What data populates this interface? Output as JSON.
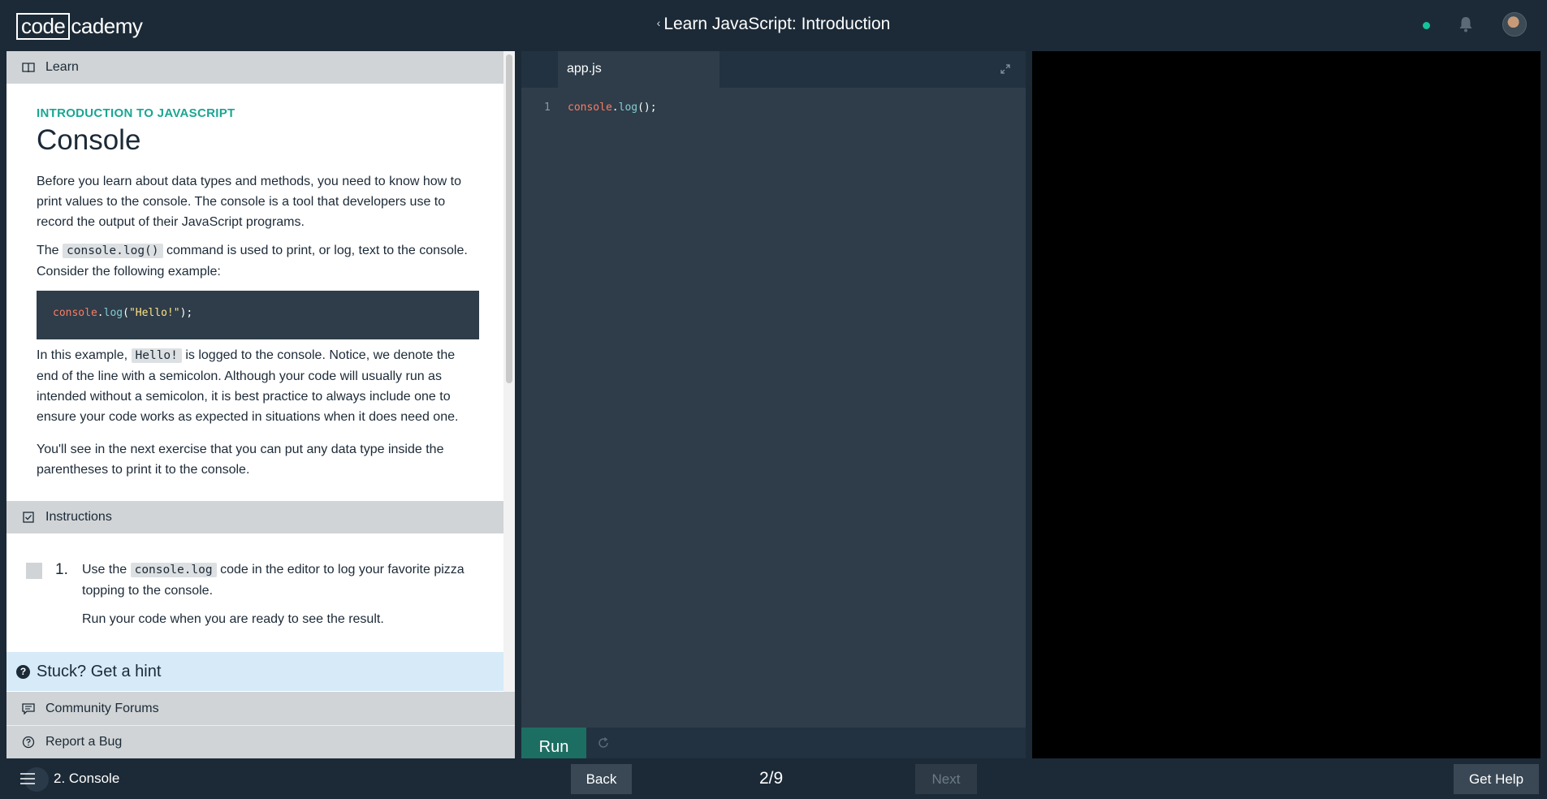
{
  "header": {
    "logo_code": "code",
    "logo_rest": "cademy",
    "course_title": "Learn JavaScript: Introduction"
  },
  "learn": {
    "section_label": "Learn",
    "eyebrow": "INTRODUCTION TO JAVASCRIPT",
    "title": "Console",
    "p1": "Before you learn about data types and methods, you need to know how to print values to the console. The console is a tool that developers use to record the output of their JavaScript programs.",
    "p2_a": "The ",
    "p2_code": "console.log()",
    "p2_b": " command is used to print, or log, text to the console. Consider the following example:",
    "example": {
      "obj": "console",
      "dot": ".",
      "fn": "log",
      "open": "(",
      "str": "\"Hello!\"",
      "close": ");"
    },
    "p3_a": "In this example, ",
    "p3_code": "Hello!",
    "p3_b": " is logged to the console. Notice, we denote the end of the line with a semicolon. Although your code will usually run as intended without a semicolon, it is best practice to always include one to ensure your code works as expected in situations when it does need one.",
    "p4": "You'll see in the next exercise that you can put any data type inside the parentheses to print it to the console."
  },
  "instructions": {
    "section_label": "Instructions",
    "items": [
      {
        "number": "1.",
        "text_a": "Use the ",
        "code": "console.log",
        "text_b": " code in the editor to log your favorite pizza topping to the console.",
        "note": "Run your code when you are ready to see the result."
      }
    ],
    "hint": "Stuck? Get a hint"
  },
  "links": {
    "forums": "Community Forums",
    "bug": "Report a Bug"
  },
  "editor": {
    "tab": "app.js",
    "line_number": "1",
    "code": {
      "obj": "console",
      "dot": ".",
      "fn": "log",
      "rest": "();"
    },
    "run_label": "Run"
  },
  "footer": {
    "lesson": "2. Console",
    "back": "Back",
    "progress": "2/9",
    "next": "Next",
    "help": "Get Help"
  },
  "colors": {
    "topbar": "#1c2a37",
    "accent": "#1aa692",
    "editor_bg": "#2e3d49",
    "run_button": "#1c6e62",
    "hint_bg": "#d6eaf8",
    "status_dot": "#15c39a"
  },
  "icons": [
    "book-icon",
    "checkbox-icon",
    "question-icon",
    "comment-icon",
    "help-circle-icon",
    "expand-icon",
    "reset-icon",
    "menu-icon",
    "bell-icon"
  ]
}
